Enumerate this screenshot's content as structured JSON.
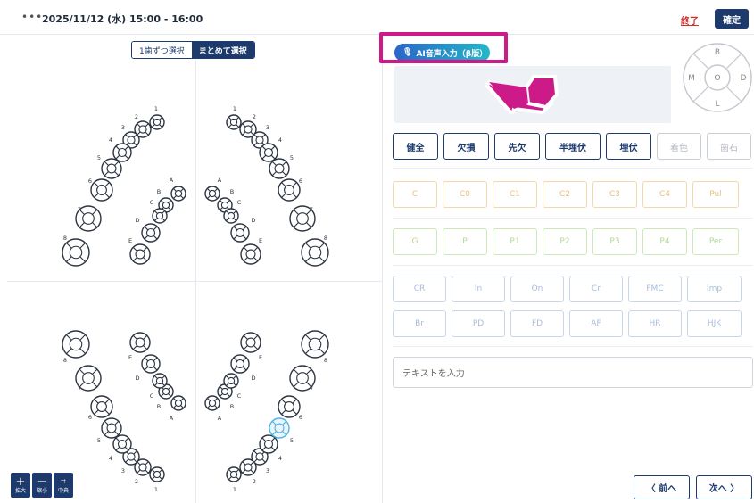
{
  "header": {
    "menu_icon": "more-horizontal-icon",
    "datetime": "2025/11/12 (水) 15:00 - 16:00",
    "end_label": "終了",
    "confirm_label": "確定"
  },
  "left": {
    "select_mode": [
      "1歯ずつ選択",
      "まとめて選択"
    ],
    "selected_mode": "まとめて選択",
    "zoom": [
      {
        "icon": "plus-icon",
        "label": "拡大"
      },
      {
        "icon": "minus-icon",
        "label": "縮小"
      },
      {
        "icon": "center-icon",
        "label": "中央"
      }
    ],
    "tooth_labels": {
      "upper_right": [
        "1",
        "2",
        "3",
        "4",
        "5",
        "6",
        "7",
        "8"
      ],
      "upper_right_primary": [
        "A",
        "B",
        "C",
        "D",
        "E"
      ],
      "upper_left": [
        "1",
        "2",
        "3",
        "4",
        "5",
        "6",
        "7",
        "8"
      ],
      "upper_left_primary": [
        "A",
        "B",
        "C",
        "D",
        "E"
      ],
      "lower_right": [
        "8",
        "7",
        "6",
        "5",
        "4",
        "3",
        "2",
        "1"
      ],
      "lower_right_primary": [
        "E",
        "D",
        "C",
        "B",
        "A"
      ],
      "lower_left": [
        "8",
        "7",
        "6",
        "5",
        "4",
        "3",
        "2",
        "1"
      ],
      "lower_left_primary": [
        "E",
        "D",
        "C",
        "B",
        "A"
      ]
    },
    "selected_tooth": "lower-left-5"
  },
  "right": {
    "ai_button": "AI音声入力（β版）",
    "ai_icon": "microphone-sparkle-icon",
    "surface_labels": {
      "top": "B",
      "left": "M",
      "center": "O",
      "right": "D",
      "bottom": "L"
    },
    "status_buttons": [
      "健全",
      "欠損",
      "先欠",
      "半埋伏",
      "埋伏",
      "着色",
      "歯石"
    ],
    "caries_buttons": [
      "C",
      "C0",
      "C1",
      "C2",
      "C3",
      "C4",
      "Pul"
    ],
    "perio_buttons": [
      "G",
      "P",
      "P1",
      "P2",
      "P3",
      "P4",
      "Per"
    ],
    "prosth_row1": [
      "CR",
      "In",
      "On",
      "Cr",
      "FMC",
      "Imp"
    ],
    "prosth_row2": [
      "Br",
      "PD",
      "FD",
      "AF",
      "HR",
      "HJK"
    ],
    "text_placeholder": "テキストを入力",
    "prev_label": "〈 前へ",
    "next_label": "次へ 〉"
  },
  "colors": {
    "primary": "#1c3a6b",
    "end_link": "#d0312d",
    "highlight": "#cc1a89",
    "selected_tooth": "#4fb3e0"
  }
}
